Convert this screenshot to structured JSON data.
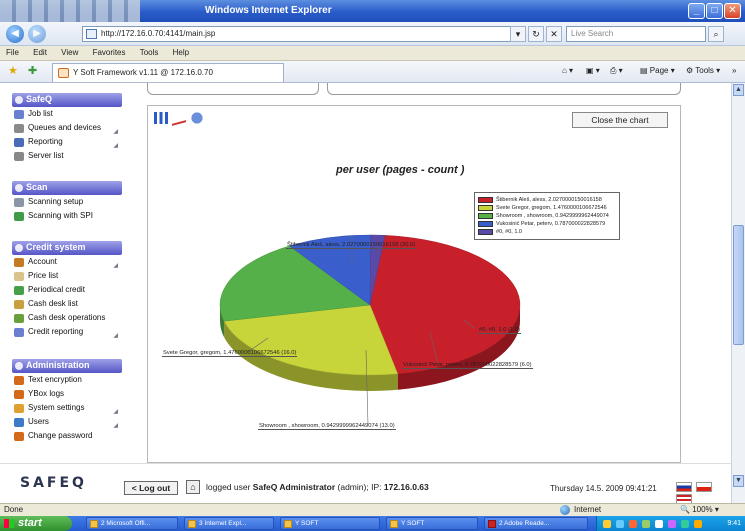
{
  "window": {
    "title": "Windows Internet Explorer",
    "controls": [
      "_",
      "□",
      "✕"
    ]
  },
  "addressbar": {
    "url": "http://172.16.0.70:4141/main.jsp",
    "search_placeholder": "Live Search"
  },
  "menubar": [
    "File",
    "Edit",
    "View",
    "Favorites",
    "Tools",
    "Help"
  ],
  "favorites_bar": {
    "tab_label": "Y Soft Framework v1.11 @ 172.16.0.70",
    "tools": {
      "page": "Page",
      "tools": "Tools"
    }
  },
  "sidebar": {
    "sections": [
      {
        "title": "SafeQ",
        "items": [
          {
            "label": "Job list",
            "icon": "list-icon",
            "color": "#6a7fd0",
            "submenu": false
          },
          {
            "label": "Queues and devices",
            "icon": "printer-icon",
            "color": "#8a8a8a",
            "submenu": true
          },
          {
            "label": "Reporting",
            "icon": "report-icon",
            "color": "#4a6bb8",
            "submenu": true
          },
          {
            "label": "Server list",
            "icon": "server-icon",
            "color": "#888",
            "submenu": false
          }
        ]
      },
      {
        "title": "Scan",
        "items": [
          {
            "label": "Scanning setup",
            "icon": "scanner-icon",
            "color": "#8a96a8",
            "submenu": false
          },
          {
            "label": "Scanning with SPI",
            "icon": "scanner-spi-icon",
            "color": "#3f9b48",
            "submenu": false
          }
        ]
      },
      {
        "title": "Credit system",
        "items": [
          {
            "label": "Account",
            "icon": "account-icon",
            "color": "#c47a24",
            "submenu": true
          },
          {
            "label": "Price list",
            "icon": "pricelist-icon",
            "color": "#d8c38a",
            "submenu": false
          },
          {
            "label": "Periodical credit",
            "icon": "periodical-icon",
            "color": "#46a04a",
            "submenu": false
          },
          {
            "label": "Cash desk list",
            "icon": "cashdesk-icon",
            "color": "#c8a040",
            "submenu": false
          },
          {
            "label": "Cash desk operations",
            "icon": "cash-ops-icon",
            "color": "#6aa03c",
            "submenu": false
          },
          {
            "label": "Credit reporting",
            "icon": "credit-report-icon",
            "color": "#6a7fd0",
            "submenu": true
          }
        ]
      },
      {
        "title": "Administration",
        "items": [
          {
            "label": "Text encryption",
            "icon": "encryption-icon",
            "color": "#d26a1a",
            "submenu": false
          },
          {
            "label": "YBox logs",
            "icon": "logs-icon",
            "color": "#d26a1a",
            "submenu": false
          },
          {
            "label": "System settings",
            "icon": "settings-icon",
            "color": "#e0a030",
            "submenu": true
          },
          {
            "label": "Users",
            "icon": "users-icon",
            "color": "#3e7ac8",
            "submenu": true
          },
          {
            "label": "Change password",
            "icon": "password-icon",
            "color": "#d26a1a",
            "submenu": false
          }
        ]
      }
    ]
  },
  "chart_panel": {
    "close_label": "Close the chart",
    "chart_data": {
      "type": "pie",
      "title": "per user (pages - count )",
      "slices": [
        {
          "label": "Štibernik Aleš, aless, 2.0270000150016158 (30.0)",
          "legend": "Štibernik Aleš, aless, 2.0270000150016158",
          "value": 30.0,
          "color": "#c8202a"
        },
        {
          "label": "Svete Gregor, gregom, 1.4760000106672546 (16.0)",
          "legend": "Svete Gregor, gregom, 1.4760000106672546",
          "value": 16.0,
          "color": "#c7d43a"
        },
        {
          "label": "Showroom , showroom, 0.9429999962449074 (13.0)",
          "legend": "Showroom , showroom, 0.9429999962449074",
          "value": 13.0,
          "color": "#55b04a"
        },
        {
          "label": "Vukosinić Petar, peterv, 0.787000022828579 (6.0)",
          "legend": "Vukosinić Petar, peterv, 0.787000022828579",
          "value": 6.0,
          "color": "#3a5fcc"
        },
        {
          "label": "#0, #0, 1.0 (1.0)",
          "legend": "#0, #0, 1.0",
          "value": 1.0,
          "color": "#5a4aa8"
        }
      ]
    }
  },
  "footer": {
    "logo": "SAFEQ",
    "logout_label": "Log out",
    "user_prefix": "logged user",
    "user_name": "SafeQ Administrator",
    "user_role": "(admin);",
    "ip_prefix": "IP:",
    "ip": "172.16.0.63",
    "datetime": "Thursday 14.5. 2009 09:41:21"
  },
  "statusbar": {
    "status": "Done",
    "zone": "Internet",
    "zoom": "100%"
  },
  "taskbar": {
    "start_label": "start",
    "tasks": [
      "2 Microsoft Offi...",
      "3 Internet Expl...",
      "Y SOFT",
      "Y SOFT",
      "2 Adobe Reade..."
    ],
    "clock": "9:41"
  }
}
